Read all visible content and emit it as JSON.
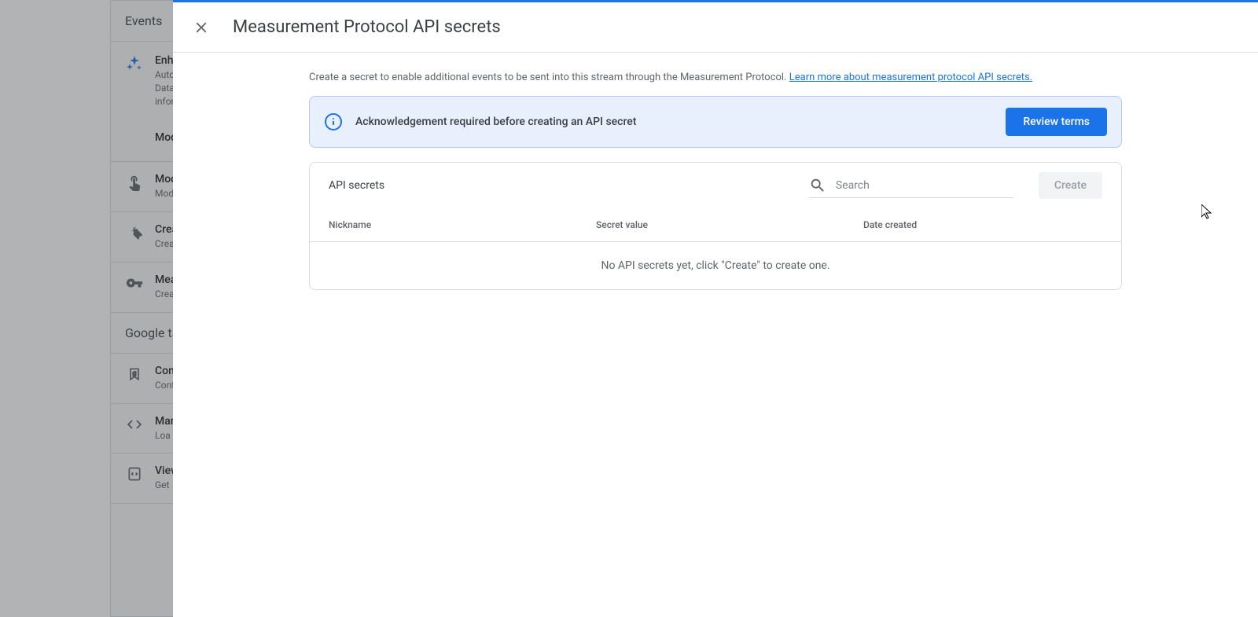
{
  "background": {
    "section_events": "Events",
    "section_googletag": "Google tag",
    "enhanced_title": "Enhanced",
    "enhanced_line1": "Autom",
    "enhanced_line2": "Data fr",
    "enhanced_line3": "inform",
    "row_modify": "Modify",
    "row_measure_title": "Modify",
    "row_measure_sub": "Modify",
    "row_create_title": "Create",
    "row_create_sub": "Crea",
    "row_mp_title": "Measur",
    "row_mp_sub": "Crea",
    "row_config_title": "Config",
    "row_config_sub": "Confi",
    "row_manage_title": "Manag",
    "row_manage_sub": "Loa",
    "row_view_title": "View",
    "row_view_sub": "Get"
  },
  "modal": {
    "title": "Measurement Protocol API secrets",
    "intro": "Create a secret to enable additional events to be sent into this stream through the Measurement Protocol. ",
    "intro_link": "Learn more about measurement protocol API secrets.",
    "ack_text": "Acknowledgement required before creating an API secret",
    "review_btn": "Review terms",
    "secrets_label": "API secrets",
    "search_placeholder": "Search",
    "create_btn": "Create",
    "columns": {
      "nickname": "Nickname",
      "secret_value": "Secret value",
      "date_created": "Date created"
    },
    "empty_state": "No API secrets yet, click \"Create\" to create one."
  }
}
